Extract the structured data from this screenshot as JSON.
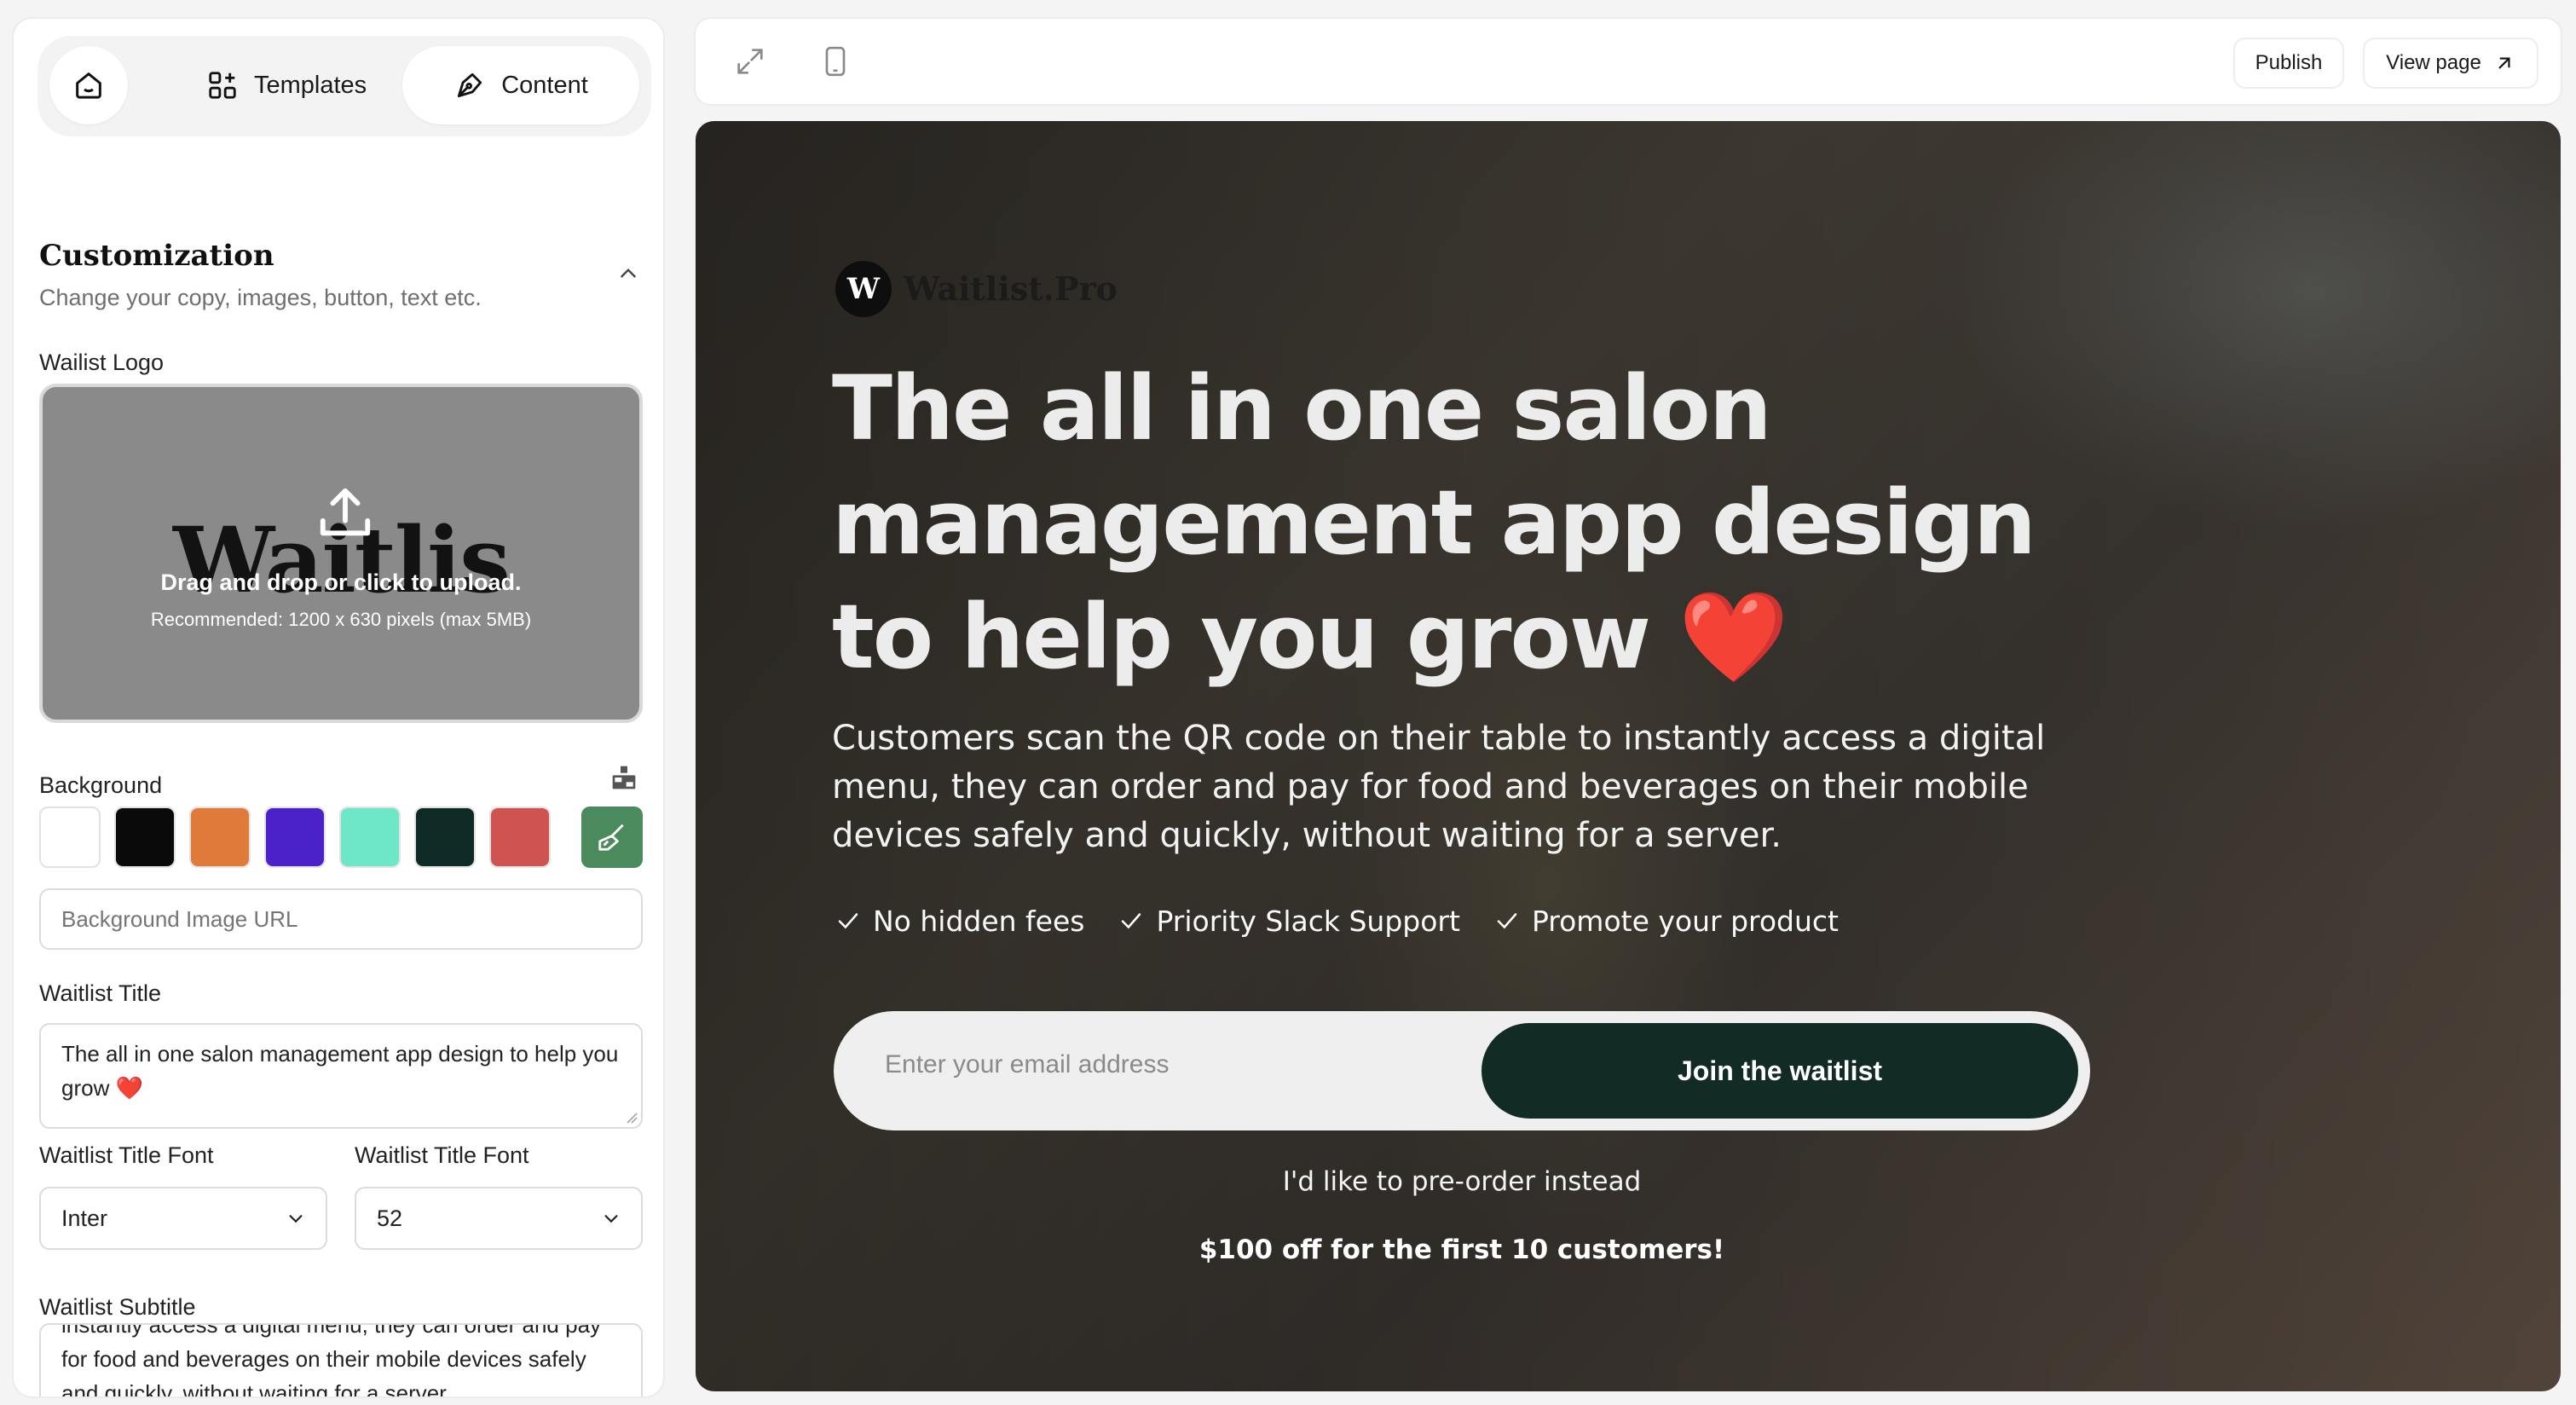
{
  "nav": {
    "templates_label": "Templates",
    "content_label": "Content"
  },
  "customization": {
    "title": "Customization",
    "subtitle": "Change your copy, images, button, text etc."
  },
  "logo_field": {
    "label": "Wailist Logo",
    "logo_text": "Waitlis",
    "upload_text": "Drag and drop or click to upload.",
    "upload_hint": "Recommended: 1200 x 630 pixels (max 5MB)"
  },
  "background_field": {
    "label": "Background",
    "swatches": [
      "#ffffff",
      "#0a0a0a",
      "#e07a3a",
      "#4a22c8",
      "#6ee6c8",
      "#0f2a24",
      "#cf5351"
    ],
    "picker_color": "#4b8a5c",
    "image_url_placeholder": "Background Image URL"
  },
  "title_field": {
    "label": "Waitlist Title",
    "value": "The all in one salon management app design to help you grow ❤️"
  },
  "title_font_field": {
    "label": "Waitlist Title Font",
    "value": "Inter"
  },
  "title_size_field": {
    "label": "Waitlist Title Font",
    "value": "52"
  },
  "subtitle_field": {
    "label": "Waitlist Subtitle",
    "value": "instantly access a digital menu, they can order and pay for food and beverages on their mobile devices safely and quickly, without waiting for a server."
  },
  "topbar": {
    "publish_label": "Publish",
    "view_page_label": "View page"
  },
  "preview": {
    "brand_initial": "W",
    "brand_name": "Waitlist.Pro",
    "title": "The all in one salon management app design to help you grow",
    "title_emoji": "❤️",
    "subtitle": "Customers scan the QR code on their table to instantly access a digital menu, they can order and pay for food and beverages on their mobile devices safely and quickly, without waiting for a server.",
    "features": [
      "No hidden fees",
      "Priority Slack Support",
      "Promote your product"
    ],
    "email_placeholder": "Enter your email address",
    "join_label": "Join the waitlist",
    "preorder_label": "I'd like to pre-order instead",
    "promo_text": "$100 off for the first 10 customers!",
    "button_color": "#122b25"
  }
}
